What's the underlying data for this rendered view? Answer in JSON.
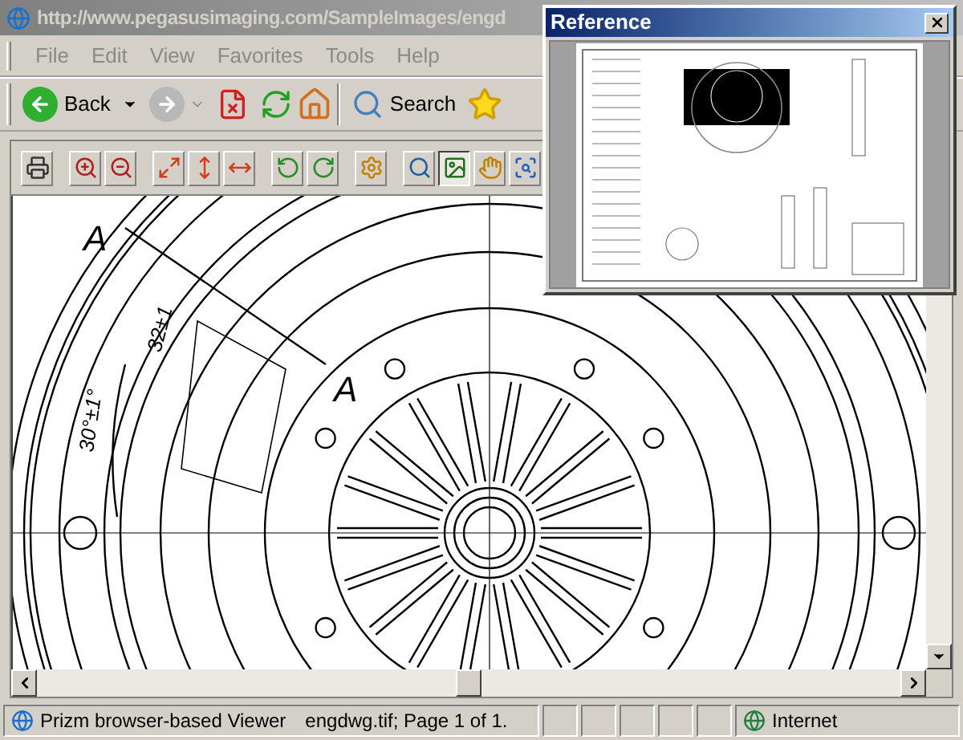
{
  "window": {
    "title": "http://www.pegasusimaging.com/SampleImages/engd"
  },
  "menu_bar": {
    "items": [
      "File",
      "Edit",
      "View",
      "Favorites",
      "Tools",
      "Help"
    ]
  },
  "toolbar": {
    "back": "Back",
    "search": "Search"
  },
  "viewer_toolbar": {
    "tools": [
      {
        "kind": "print",
        "selected": false
      },
      {
        "kind": "zoom-in",
        "selected": false
      },
      {
        "kind": "zoom-out",
        "selected": false
      },
      {
        "kind": "fit-all",
        "selected": false
      },
      {
        "kind": "fit-height",
        "selected": false
      },
      {
        "kind": "fit-width",
        "selected": false
      },
      {
        "kind": "rotate-left",
        "selected": false
      },
      {
        "kind": "rotate-right",
        "selected": false
      },
      {
        "kind": "settings",
        "selected": false
      },
      {
        "kind": "magnify",
        "selected": false
      },
      {
        "kind": "fit-image",
        "selected": true
      },
      {
        "kind": "pan",
        "selected": false
      },
      {
        "kind": "zoom-area",
        "selected": false
      }
    ]
  },
  "drawing": {
    "labels": [
      "A",
      "A",
      "32±1",
      "30°±1°"
    ]
  },
  "reference": {
    "title": "Reference"
  },
  "status_bar": {
    "text": "Prizm browser-based Viewer",
    "document": "engdwg.tif; Page 1 of 1.",
    "zone": "Internet"
  }
}
